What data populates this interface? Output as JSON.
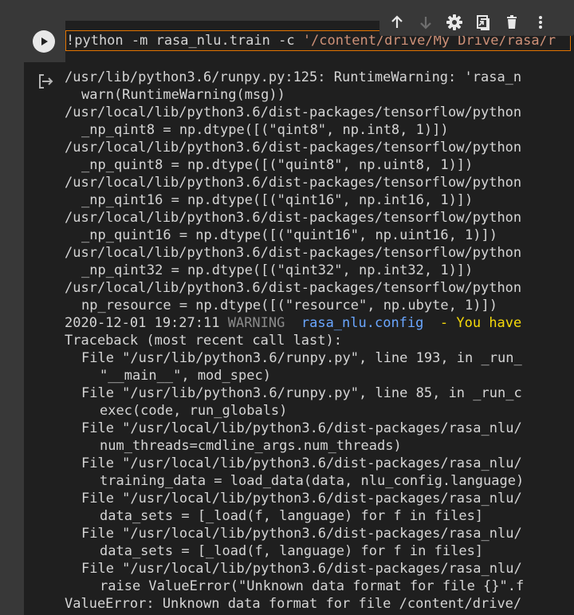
{
  "cell": {
    "code": {
      "prefix": "!python -m rasa_nlu.train -c ",
      "path_string": "'/content/drive/My Drive/rasa/r"
    },
    "toolbar": {
      "icons": [
        "arrow-up-icon",
        "arrow-down-icon",
        "gear-icon",
        "mirror-cell-icon",
        "trash-icon",
        "more-vert-icon"
      ]
    }
  },
  "output": {
    "lines": [
      {
        "text": "/usr/lib/python3.6/runpy.py:125: RuntimeWarning: 'rasa_n",
        "indent": 0
      },
      {
        "text": "warn(RuntimeWarning(msg))",
        "indent": 1
      },
      {
        "text": "/usr/local/lib/python3.6/dist-packages/tensorflow/python",
        "indent": 0
      },
      {
        "text": "_np_qint8 = np.dtype([(\"qint8\", np.int8, 1)])",
        "indent": 1
      },
      {
        "text": "/usr/local/lib/python3.6/dist-packages/tensorflow/python",
        "indent": 0
      },
      {
        "text": "_np_quint8 = np.dtype([(\"quint8\", np.uint8, 1)])",
        "indent": 1
      },
      {
        "text": "/usr/local/lib/python3.6/dist-packages/tensorflow/python",
        "indent": 0
      },
      {
        "text": "_np_qint16 = np.dtype([(\"qint16\", np.int16, 1)])",
        "indent": 1
      },
      {
        "text": "/usr/local/lib/python3.6/dist-packages/tensorflow/python",
        "indent": 0
      },
      {
        "text": "_np_quint16 = np.dtype([(\"quint16\", np.uint16, 1)])",
        "indent": 1
      },
      {
        "text": "/usr/local/lib/python3.6/dist-packages/tensorflow/python",
        "indent": 0
      },
      {
        "text": "_np_qint32 = np.dtype([(\"qint32\", np.int32, 1)])",
        "indent": 1
      },
      {
        "text": "/usr/local/lib/python3.6/dist-packages/tensorflow/python",
        "indent": 0
      },
      {
        "text": "np_resource = np.dtype([(\"resource\", np.ubyte, 1)])",
        "indent": 1
      },
      {
        "log": true
      },
      {
        "text": "Traceback (most recent call last):",
        "indent": 0
      },
      {
        "text": "File \"/usr/lib/python3.6/runpy.py\", line 193, in _run_",
        "indent": 1
      },
      {
        "text": "\"__main__\", mod_spec)",
        "indent": 2
      },
      {
        "text": "File \"/usr/lib/python3.6/runpy.py\", line 85, in _run_c",
        "indent": 1
      },
      {
        "text": "exec(code, run_globals)",
        "indent": 2
      },
      {
        "text": "File \"/usr/local/lib/python3.6/dist-packages/rasa_nlu/",
        "indent": 1
      },
      {
        "text": "num_threads=cmdline_args.num_threads)",
        "indent": 2
      },
      {
        "text": "File \"/usr/local/lib/python3.6/dist-packages/rasa_nlu/",
        "indent": 1
      },
      {
        "text": "training_data = load_data(data, nlu_config.language)",
        "indent": 2
      },
      {
        "text": "File \"/usr/local/lib/python3.6/dist-packages/rasa_nlu/",
        "indent": 1
      },
      {
        "text": "data_sets = [_load(f, language) for f in files]",
        "indent": 2
      },
      {
        "text": "File \"/usr/local/lib/python3.6/dist-packages/rasa_nlu/",
        "indent": 1
      },
      {
        "text": "data_sets = [_load(f, language) for f in files]",
        "indent": 2
      },
      {
        "text": "File \"/usr/local/lib/python3.6/dist-packages/rasa_nlu/",
        "indent": 1
      },
      {
        "text": "raise ValueError(\"Unknown data format for file {}\".f",
        "indent": 2
      },
      {
        "text": "ValueError: Unknown data format for file /content/drive/",
        "indent": 0
      }
    ],
    "log_line": {
      "timestamp": "2020-12-01 19:27:11",
      "level": "WARNING",
      "logger": "rasa_nlu.config",
      "separator": "-",
      "message": "You have"
    }
  },
  "colors": {
    "background": "#383838",
    "cell_background": "#1f1f1f",
    "editor_border": "#e37400",
    "string": "#ce9178",
    "logger": "#6aa6ff",
    "message": "#f5d90a",
    "level": "#8a8a8a"
  }
}
